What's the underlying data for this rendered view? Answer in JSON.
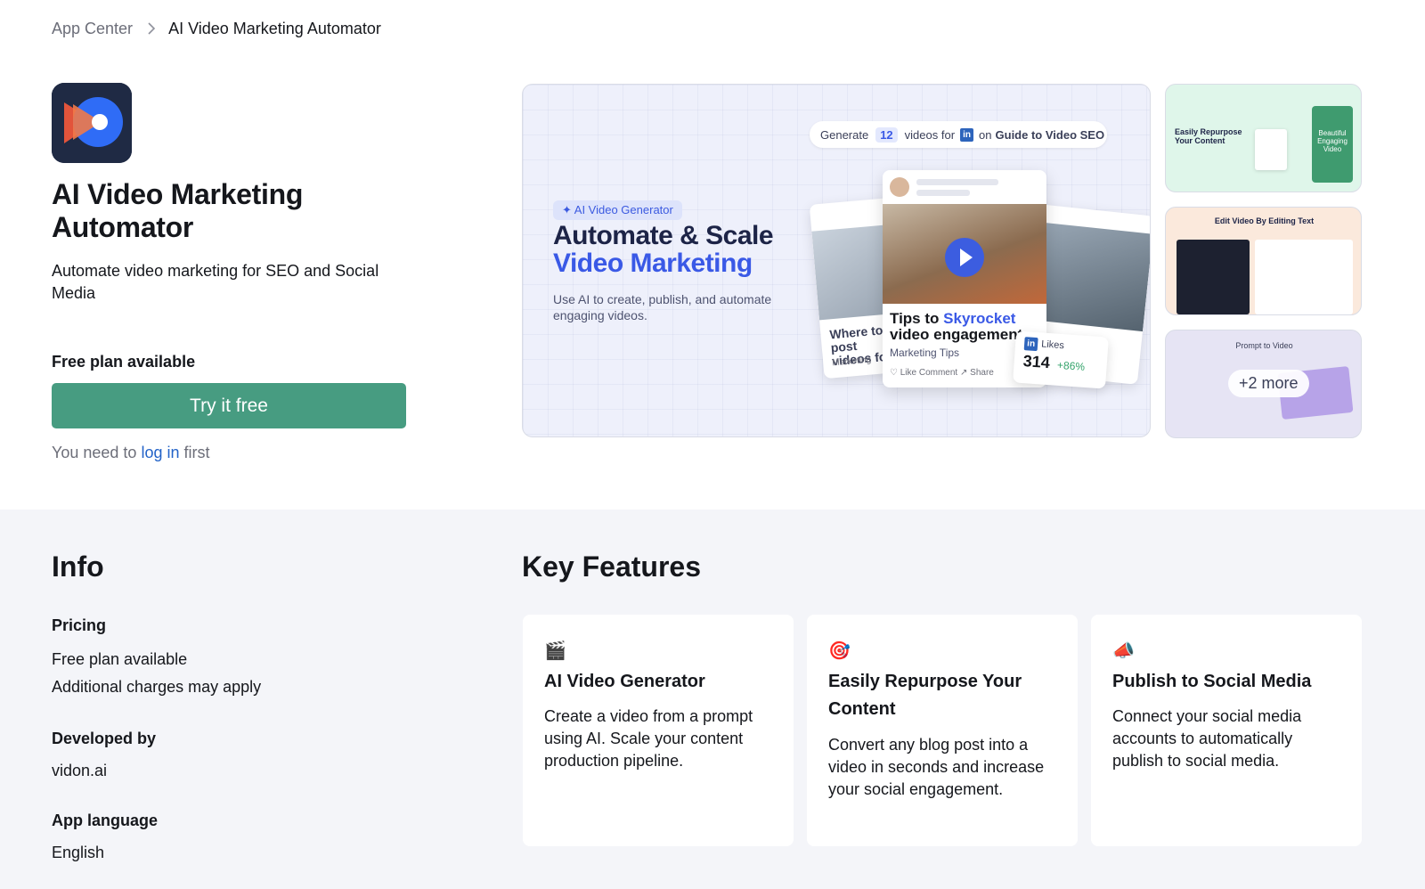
{
  "breadcrumb": {
    "root": "App Center",
    "current": "AI Video Marketing Automator"
  },
  "app": {
    "title": "AI Video Marketing Automator",
    "subtitle": "Automate video marketing for SEO and Social Media",
    "plan_label": "Free plan available",
    "cta_label": "Try it free",
    "login_note": {
      "prefix": "You need to",
      "link": "log in",
      "suffix": "first"
    }
  },
  "gallery": {
    "main": {
      "tag": "✦ AI Video Generator",
      "headline_1": "Automate & Scale",
      "headline_2": "Video Marketing",
      "description": "Use AI to create, publish, and automate engaging videos.",
      "generate_pill": {
        "prefix": "Generate",
        "count": "12",
        "middle": "videos for",
        "network_badge": "in",
        "on": "on",
        "target": "Guide to Video SEO"
      },
      "video_card": {
        "title_1": "Tips to",
        "title_highlight": "Skyrocket",
        "title_2": "video engagement",
        "subtitle": "Marketing Tips",
        "actions": "♡ Like    Comment    ↗ Share"
      },
      "back_left_card": {
        "title": "Where to post videos for",
        "subtitle": "Marketing"
      },
      "back_right_card": {
        "title": "arted"
      },
      "likes_card": {
        "label": "Likes",
        "value": "314",
        "change": "+86%"
      }
    },
    "thumbnails": [
      {
        "caption": "Easily Repurpose Your Content",
        "side": "Beautiful Engaging Video"
      },
      {
        "caption": "Edit Video By Editing Text"
      },
      {
        "caption": "Prompt to Video",
        "more": "+2 more"
      }
    ]
  },
  "info": {
    "heading": "Info",
    "pricing_label": "Pricing",
    "pricing_values": [
      "Free plan available",
      "Additional charges may apply"
    ],
    "developer_label": "Developed by",
    "developer": "vidon.ai",
    "language_label": "App language",
    "language": "English"
  },
  "key_features": {
    "heading": "Key Features",
    "items": [
      {
        "icon": "🎬",
        "icon_name": "clapper-board-icon",
        "title": "AI Video Generator",
        "description": "Create a video from a prompt using AI. Scale your content production pipeline."
      },
      {
        "icon": "🎯",
        "icon_name": "target-icon",
        "title": "Easily Repurpose Your Content",
        "description": "Convert any blog post into a video in seconds and increase your social engagement."
      },
      {
        "icon": "📣",
        "icon_name": "megaphone-icon",
        "title": "Publish to Social Media",
        "description": "Connect your social media accounts to automatically publish to social media."
      }
    ]
  },
  "colors": {
    "cta": "#479c81",
    "link": "#2363c8",
    "accent_blue": "#3a59e6",
    "section_bg": "#f4f5f9"
  }
}
